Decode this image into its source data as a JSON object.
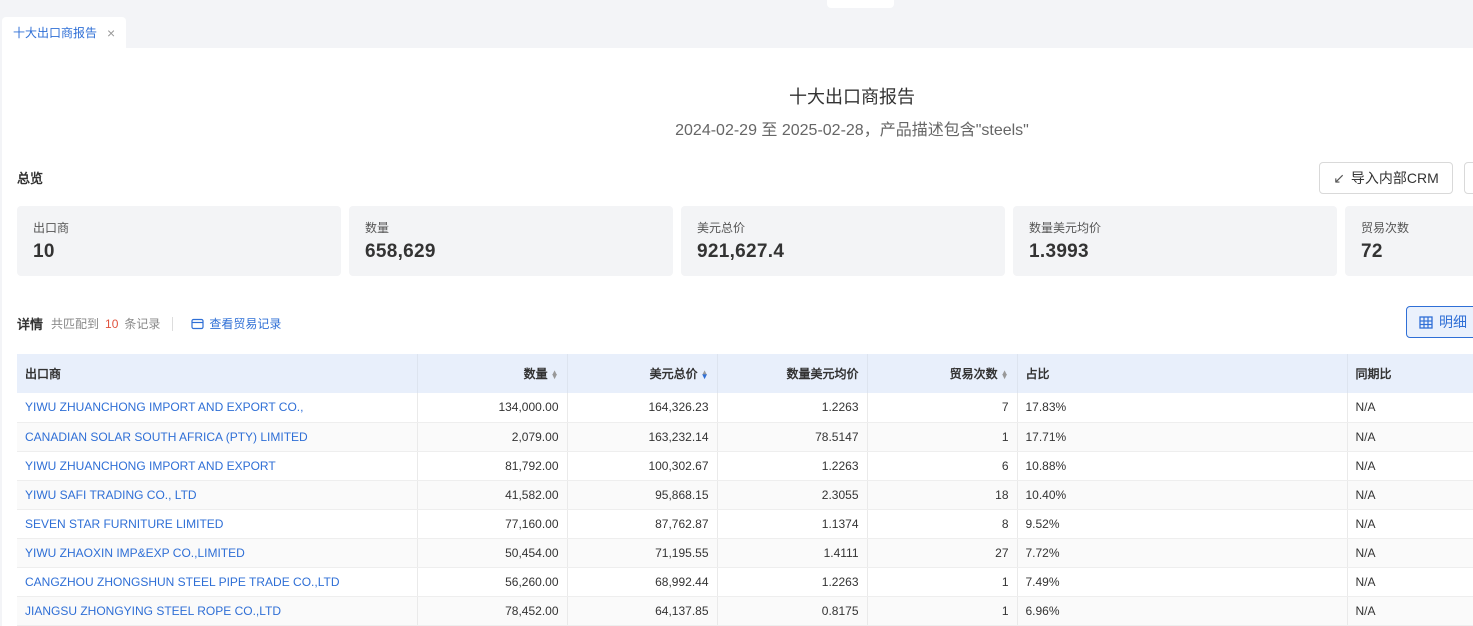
{
  "tab": {
    "label": "十大出口商报告"
  },
  "report": {
    "title": "十大出口商报告",
    "subtitle": "2024-02-29 至 2025-02-28，产品描述包含\"steels\""
  },
  "overview": {
    "label": "总览",
    "crm_button": "导入内部CRM",
    "stats": [
      {
        "label": "出口商",
        "value": "10"
      },
      {
        "label": "数量",
        "value": "658,629"
      },
      {
        "label": "美元总价",
        "value": "921,627.4"
      },
      {
        "label": "数量美元均价",
        "value": "1.3993"
      },
      {
        "label": "贸易次数",
        "value": "72"
      }
    ]
  },
  "detail": {
    "title": "详情",
    "matched_prefix": "共匹配到",
    "matched_count": "10",
    "matched_suffix": "条记录",
    "trade_link": "查看贸易记录",
    "mingxi_button": "明细"
  },
  "table": {
    "headers": [
      "出口商",
      "数量",
      "美元总价",
      "数量美元均价",
      "贸易次数",
      "占比",
      "同期比"
    ],
    "rows": [
      [
        "YIWU ZHUANCHONG IMPORT AND EXPORT CO.,",
        "134,000.00",
        "164,326.23",
        "1.2263",
        "7",
        "17.83%",
        "N/A"
      ],
      [
        "CANADIAN SOLAR SOUTH AFRICA (PTY) LIMITED",
        "2,079.00",
        "163,232.14",
        "78.5147",
        "1",
        "17.71%",
        "N/A"
      ],
      [
        "YIWU ZHUANCHONG IMPORT AND EXPORT",
        "81,792.00",
        "100,302.67",
        "1.2263",
        "6",
        "10.88%",
        "N/A"
      ],
      [
        "YIWU SAFI TRADING CO., LTD",
        "41,582.00",
        "95,868.15",
        "2.3055",
        "18",
        "10.40%",
        "N/A"
      ],
      [
        "SEVEN STAR FURNITURE LIMITED",
        "77,160.00",
        "87,762.87",
        "1.1374",
        "8",
        "9.52%",
        "N/A"
      ],
      [
        "YIWU ZHAOXIN IMP&EXP CO.,LIMITED",
        "50,454.00",
        "71,195.55",
        "1.4111",
        "27",
        "7.72%",
        "N/A"
      ],
      [
        "CANGZHOU ZHONGSHUN STEEL PIPE TRADE CO.,LTD",
        "56,260.00",
        "68,992.44",
        "1.2263",
        "1",
        "7.49%",
        "N/A"
      ],
      [
        "JIANGSU ZHONGYING STEEL ROPE CO.,LTD",
        "78,452.00",
        "64,137.85",
        "0.8175",
        "1",
        "6.96%",
        "N/A"
      ]
    ]
  },
  "colors": {
    "accent": "#2f6fd6",
    "count_red": "#e0533e",
    "header_bg": "#e8effb"
  }
}
